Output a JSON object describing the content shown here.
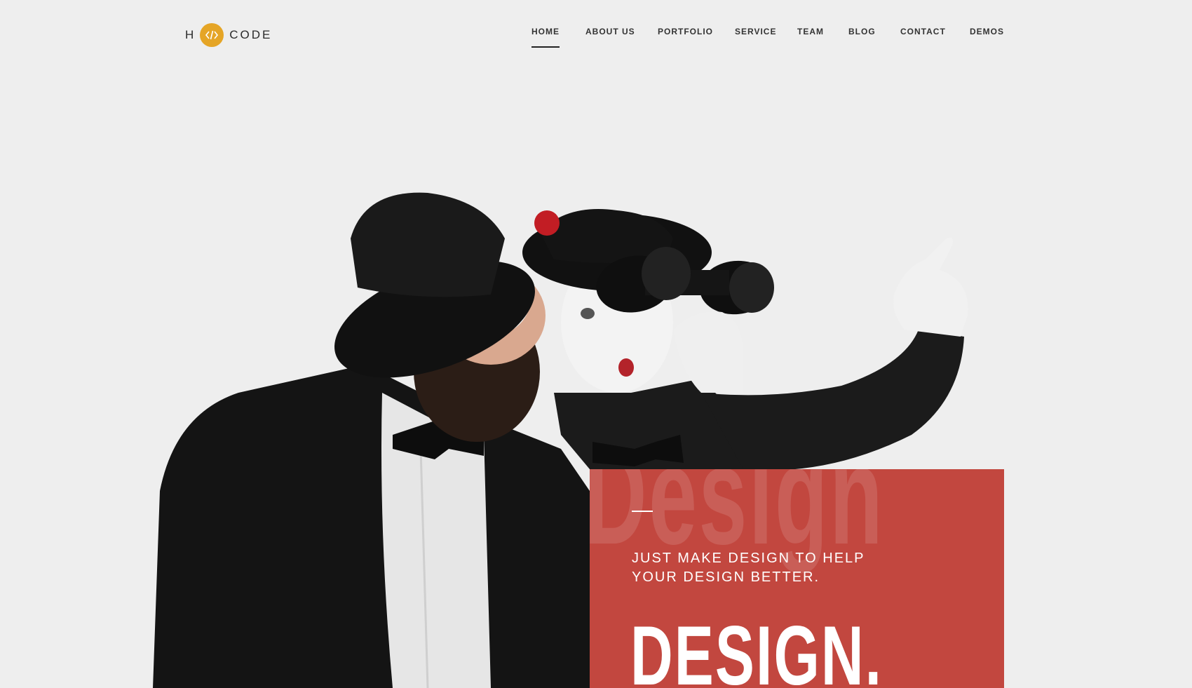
{
  "header": {
    "logo": {
      "left_letter": "H",
      "right_word": "CODE",
      "mark_icon": "code-brackets-icon"
    },
    "nav": [
      {
        "label": "HOME",
        "active": true
      },
      {
        "label": "ABOUT US",
        "active": false
      },
      {
        "label": "PORTFOLIO",
        "active": false
      },
      {
        "label": "SERVICE",
        "active": false
      },
      {
        "label": "TEAM",
        "active": false
      },
      {
        "label": "BLOG",
        "active": false
      },
      {
        "label": "CONTACT",
        "active": false
      },
      {
        "label": "DEMOS",
        "active": false
      }
    ]
  },
  "hero": {
    "image_subject": "two mimes with bowler hats, one looking through binoculars and pointing",
    "panel": {
      "background_word": "Design",
      "tagline": "JUST MAKE DESIGN TO HELP YOUR DESIGN BETTER.",
      "title": "DESIGN."
    }
  },
  "colors": {
    "background": "#eeeeee",
    "accent_logo": "#e5a526",
    "panel_red": "#c2473f",
    "text_dark": "#333333"
  }
}
